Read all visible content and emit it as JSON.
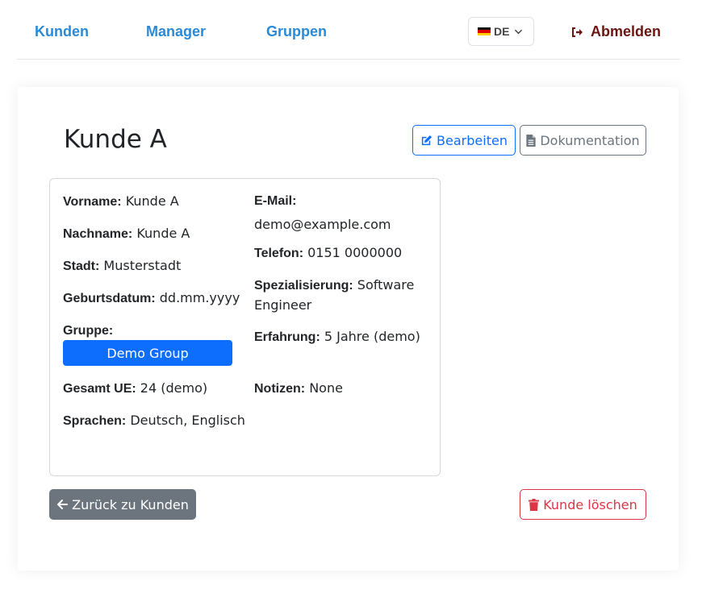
{
  "nav": {
    "items": [
      {
        "label": "Kunden"
      },
      {
        "label": "Manager"
      },
      {
        "label": "Gruppen"
      }
    ],
    "language": {
      "code": "DE",
      "flag_icon": "german-flag-icon"
    },
    "logout_label": "Abmelden"
  },
  "colors": {
    "nav_link": "#2b8ad6",
    "logout": "#6a1510",
    "primary": "#0d6efd",
    "secondary": "#6c757d",
    "danger": "#dc3545"
  },
  "customer": {
    "title": "Kunde A",
    "edit_label": "Bearbeiten",
    "docs_label": "Dokumentation",
    "left": {
      "vorname_label": "Vorname:",
      "vorname": "Kunde A",
      "nachname_label": "Nachname:",
      "nachname": "Kunde A",
      "stadt_label": "Stadt:",
      "stadt": "Musterstadt",
      "geburtsdatum_label": "Geburtsdatum:",
      "geburtsdatum": "dd.mm.yyyy",
      "gruppe_label": "Gruppe:",
      "gruppe": "Demo Group",
      "gesamt_ue_label": "Gesamt UE:",
      "gesamt_ue": "24 (demo)",
      "sprachen_label": "Sprachen:",
      "sprachen": "Deutsch, Englisch"
    },
    "right": {
      "email_label": "E-Mail:",
      "email": "demo@example.com",
      "telefon_label": "Telefon:",
      "telefon": "0151 0000000",
      "spezialisierung_label": "Spezialisierung:",
      "spezialisierung_1": "Software",
      "spezialisierung_2": "Engineer",
      "erfahrung_label": "Erfahrung:",
      "erfahrung": "5 Jahre (demo)",
      "notizen_label": "Notizen:",
      "notizen": "None"
    },
    "back_label": "Zurück zu Kunden",
    "delete_label": "Kunde löschen"
  }
}
